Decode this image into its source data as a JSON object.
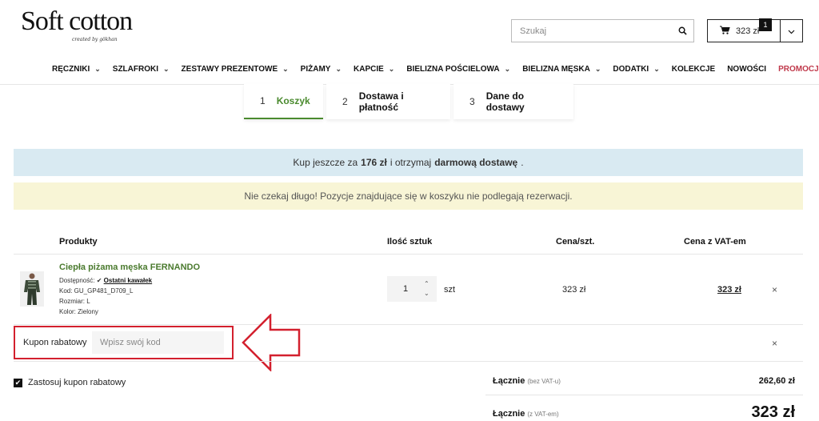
{
  "header": {
    "logo_text": "Soft cotton",
    "logo_tagline": "created by gökhan",
    "search_placeholder": "Szukaj",
    "cart_amount": "323 zł",
    "cart_count": "1"
  },
  "nav": [
    {
      "label": "RĘCZNIKI",
      "dropdown": true
    },
    {
      "label": "SZLAFROKI",
      "dropdown": true
    },
    {
      "label": "ZESTAWY PREZENTOWE",
      "dropdown": true
    },
    {
      "label": "PIŻAMY",
      "dropdown": true
    },
    {
      "label": "KAPCIE",
      "dropdown": true
    },
    {
      "label": "BIELIZNA POŚCIELOWA",
      "dropdown": true
    },
    {
      "label": "BIELIZNA MĘSKA",
      "dropdown": true
    },
    {
      "label": "DODATKI",
      "dropdown": true
    },
    {
      "label": "KOLEKCJE",
      "dropdown": false
    },
    {
      "label": "NOWOŚCI",
      "dropdown": false
    },
    {
      "label": "PROMOCJE %",
      "dropdown": false
    }
  ],
  "steps": [
    {
      "num": "1",
      "label": "Koszyk"
    },
    {
      "num": "2",
      "label": "Dostawa i płatność"
    },
    {
      "num": "3",
      "label": "Dane do dostawy"
    }
  ],
  "banners": {
    "free_shipping_prefix": "Kup jeszcze za",
    "free_shipping_amount": "176 zł",
    "free_shipping_middle": "i otrzymaj",
    "free_shipping_bold": "darmową dostawę",
    "free_shipping_suffix": ".",
    "reservation": "Nie czekaj długo! Pozycje znajdujące się w koszyku nie podlegają rezerwacji."
  },
  "table": {
    "headers": {
      "product": "Produkty",
      "qty": "Ilość sztuk",
      "unit_price": "Cena/szt.",
      "price_vat": "Cena z VAT-em"
    }
  },
  "item": {
    "name": "Ciepła piżama męska FERNANDO",
    "availability_label": "Dostępność:",
    "availability_value": "Ostatni kawałek",
    "code": "Kod: GU_GP481_D709_L",
    "size": "Rozmiar: L",
    "color": "Kolor: Zielony",
    "quantity": "1",
    "unit": "szt",
    "unit_price": "323 zł",
    "price_vat": "323 zł",
    "remove_symbol": "×"
  },
  "coupon": {
    "label": "Kupon rabatowy",
    "placeholder": "Wpisz swój kod",
    "remove_symbol": "×",
    "apply_label": "Zastosuj kupon rabatowy"
  },
  "summary": {
    "net_label": "Łącznie",
    "net_note": "(bez VAT-u)",
    "net_value": "262,60 zł",
    "gross_label": "Łącznie",
    "gross_note": "(z VAT-em)",
    "gross_value": "323 zł"
  },
  "colors": {
    "accent_green": "#4a8a2e",
    "promo_red": "#c0394b",
    "highlight_red": "#d3202e",
    "banner_blue": "#d9eaf2",
    "banner_yellow": "#f8f5d6"
  }
}
